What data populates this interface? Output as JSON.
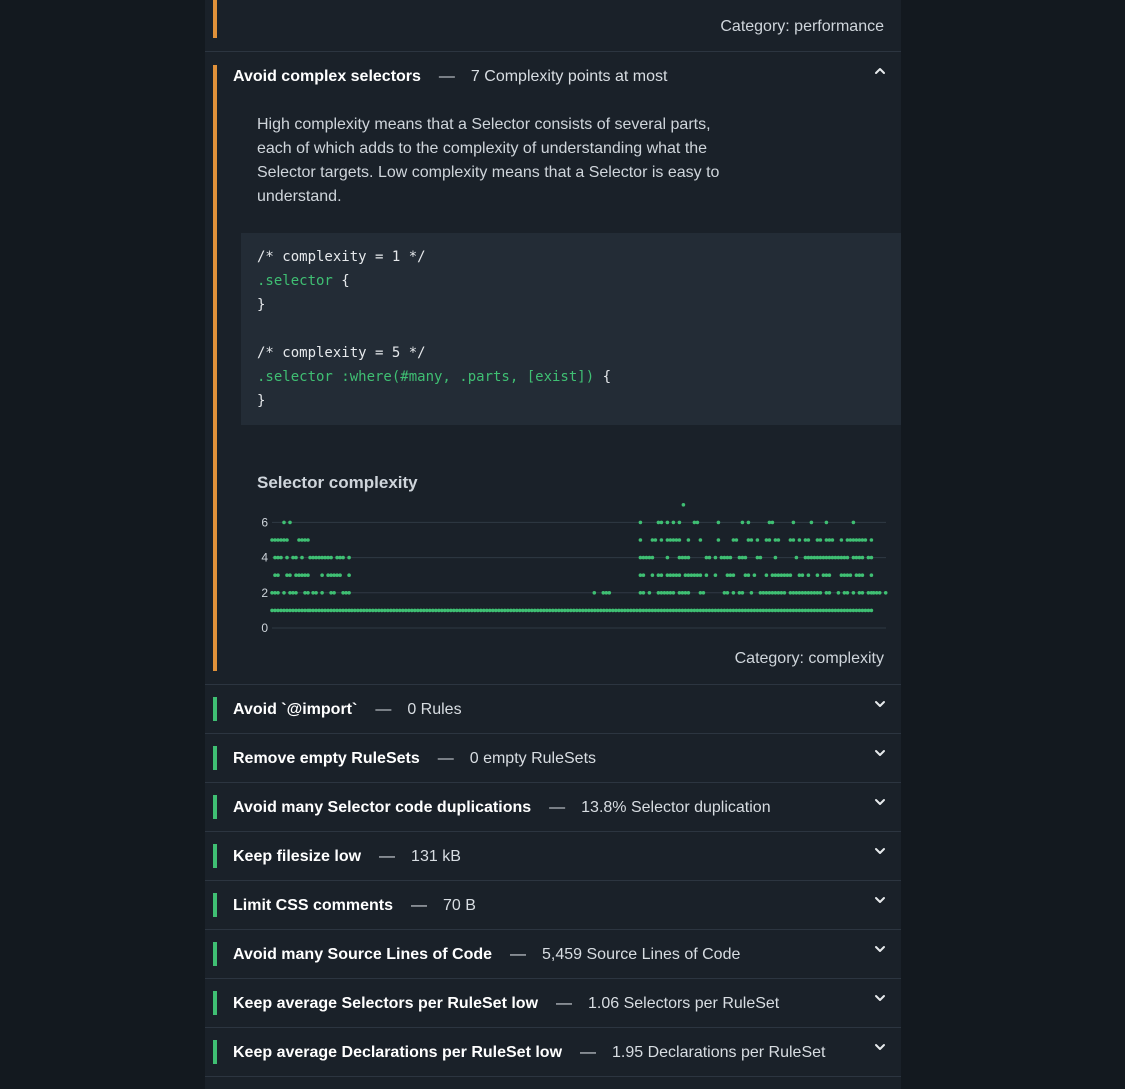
{
  "top_item": {
    "category": "Category: performance"
  },
  "complex": {
    "title": "Avoid complex selectors",
    "dash": "—",
    "summary": "7 Complexity points at most",
    "description": "High complexity means that a Selector consists of several parts, each of which adds to the complexity of understanding what the Selector targets. Low complexity means that a Selector is easy to understand.",
    "code": {
      "comment1": "/* complexity = 1 */",
      "sel1": ".selector",
      "brace_open": " {",
      "brace_close": "}",
      "comment2": "/* complexity = 5 */",
      "sel2": ".selector :where(#many, .parts, [exist])"
    },
    "chart_title": "Selector complexity",
    "category": "Category: complexity"
  },
  "chart_data": {
    "type": "scatter",
    "title": "Selector complexity",
    "xlabel": "",
    "ylabel": "",
    "yticks": [
      0,
      2,
      4,
      6
    ],
    "ylim": [
      0,
      7
    ],
    "grid": true,
    "color": "#3fbf73",
    "segments": [
      {
        "x": [
          0.0,
          0.062
        ],
        "levels": [
          1,
          2,
          3,
          4,
          5,
          6
        ]
      },
      {
        "x": [
          0.062,
          0.13
        ],
        "levels": [
          1,
          2,
          3,
          4
        ]
      },
      {
        "x": [
          0.13,
          0.6
        ],
        "levels": [
          1
        ]
      },
      {
        "x": [
          0.52,
          0.55
        ],
        "levels": [
          2
        ]
      },
      {
        "x": [
          0.6,
          0.98
        ],
        "levels": [
          1,
          2,
          3,
          4,
          5,
          6
        ]
      },
      {
        "x": [
          0.67,
          0.68
        ],
        "levels": [
          7
        ]
      },
      {
        "x": [
          0.98,
          1.0
        ],
        "levels": [
          2
        ]
      }
    ]
  },
  "collapsed_items": [
    {
      "title": "Avoid `@import`",
      "summary": "0 Rules"
    },
    {
      "title": "Remove empty RuleSets",
      "summary": "0 empty RuleSets"
    },
    {
      "title": "Avoid many Selector code duplications",
      "summary": "13.8% Selector duplication"
    },
    {
      "title": "Keep filesize low",
      "summary": "131 kB"
    },
    {
      "title": "Limit CSS comments",
      "summary": "70 B"
    },
    {
      "title": "Avoid many Source Lines of Code",
      "summary": "5,459 Source Lines of Code"
    },
    {
      "title": "Keep average Selectors per RuleSet low",
      "summary": "1.06 Selectors per RuleSet"
    },
    {
      "title": "Keep average Declarations per RuleSet low",
      "summary": "1.95 Declarations per RuleSet"
    }
  ],
  "colors": {
    "warning": "#e0913a",
    "ok": "#3fbf73"
  },
  "icons": {
    "collapse": "chevron-up-icon",
    "expand": "chevron-down-icon"
  }
}
